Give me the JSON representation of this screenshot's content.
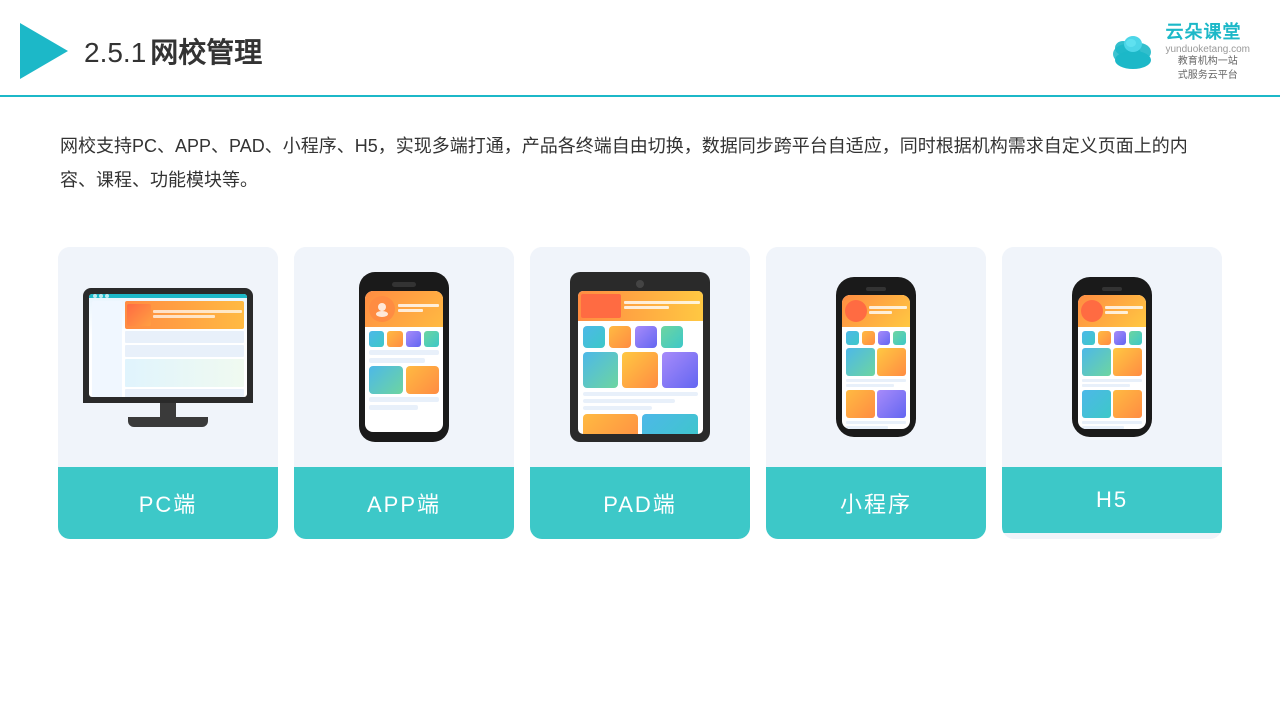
{
  "header": {
    "title_prefix": "2.5.1",
    "title_main": "网校管理",
    "brand_name": "云朵课堂",
    "brand_url": "yunduoketang.com",
    "brand_tagline_1": "教育机构一站",
    "brand_tagline_2": "式服务云平台"
  },
  "description": {
    "text": "网校支持PC、APP、PAD、小程序、H5，实现多端打通，产品各终端自由切换，数据同步跨平台自适应，同时根据机构需求自定义页面上的内容、课程、功能模块等。"
  },
  "cards": [
    {
      "id": "pc",
      "label": "PC端"
    },
    {
      "id": "app",
      "label": "APP端"
    },
    {
      "id": "pad",
      "label": "PAD端"
    },
    {
      "id": "miniapp",
      "label": "小程序"
    },
    {
      "id": "h5",
      "label": "H5"
    }
  ],
  "colors": {
    "accent": "#1cb8c8",
    "card_bg": "#f0f4fa",
    "card_label_bg": "#3dc8c8",
    "text_dark": "#333333",
    "border_bottom": "#1cb8c8"
  }
}
